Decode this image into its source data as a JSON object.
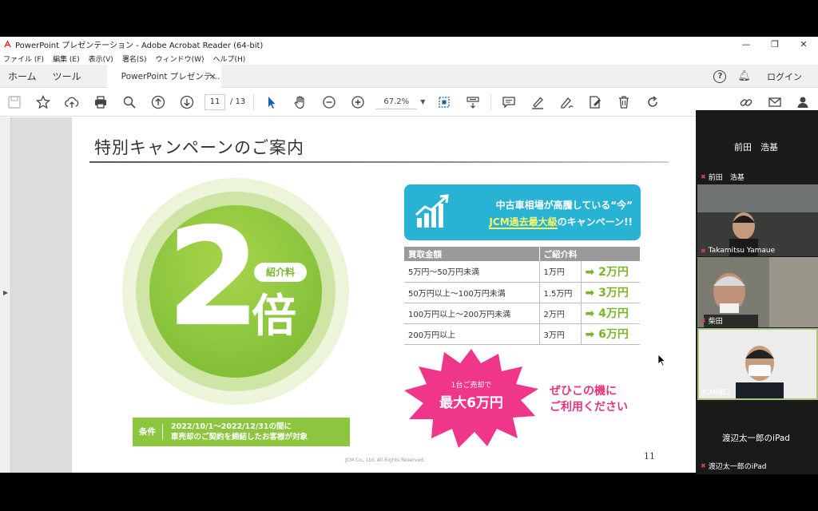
{
  "window": {
    "title": "PowerPoint プレゼンテーション - Adobe Acrobat Reader (64-bit)",
    "controls": [
      "—",
      "❐",
      "✕"
    ]
  },
  "menu": [
    "ファイル (F)",
    "編集 (E)",
    "表示(V)",
    "署名(S)",
    "ウィンドウ(W)",
    "ヘルプ(H)"
  ],
  "tabs": {
    "home": "ホーム",
    "tools": "ツール",
    "doc": "PowerPoint プレゼンテ...",
    "close": "×",
    "login": "ログイン"
  },
  "toolbar": {
    "page_current": "11",
    "page_total": "/ 13",
    "zoom": "67.2%"
  },
  "slide": {
    "title": "特別キャンペーンのご案内",
    "big_number": "2",
    "badge": "紹介料",
    "multiplier": "倍",
    "condition_label": "条件",
    "condition_line1": "2022/10/1～2022/12/31の間に",
    "condition_line2": "車売却のご契約を締結したお客様が対象",
    "banner_line1": "中古車相場が高騰している“今”",
    "banner_line2_highlight": "JCM過去最大級",
    "banner_line2_rest": "のキャンペーン!!",
    "table_headers": [
      "買取金額",
      "ご紹介料",
      ""
    ],
    "table_rows": [
      {
        "range": "5万円～50万円未満",
        "before": "1万円",
        "after": "➡ 2万円"
      },
      {
        "range": "50万円以上～100万円未満",
        "before": "1.5万円",
        "after": "➡ 3万円"
      },
      {
        "range": "100万円以上～200万円未満",
        "before": "2万円",
        "after": "➡ 4万円"
      },
      {
        "range": "200万円以上",
        "before": "3万円",
        "after": "➡ 6万円"
      }
    ],
    "burst_small": "1台ご売却で",
    "burst_big": "最大6万円",
    "cta_line1": "ぜひこの機に",
    "cta_line2": "ご利用ください",
    "page_number": "11",
    "copyright": "JCM Co., Ltd. All Rights Reserved."
  },
  "participants": {
    "header_name": "前田　浩基",
    "tile1": "前田　浩基",
    "tile2": "Takamitsu Yamaue",
    "tile3": "柴田",
    "tile4": "JCM樋口",
    "tile5_big": "渡辺太一郎のiPad",
    "tile5": "渡辺太一郎のiPad"
  },
  "colors": {
    "accent_green": "#8cc63f",
    "banner_blue": "#28b3d4",
    "burst_pink": "#f0368a",
    "cta_pink": "#e8337d"
  }
}
